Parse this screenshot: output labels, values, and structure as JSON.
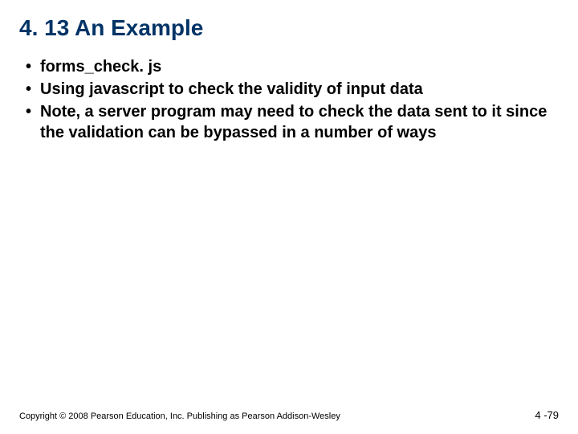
{
  "title": "4. 13 An Example",
  "bullets": [
    "forms_check. js",
    "Using javascript to check the validity of input data",
    "Note, a server program may need to check the data sent to it since the validation can be bypassed in a number of ways"
  ],
  "copyright": "Copyright © 2008 Pearson Education, Inc. Publishing as Pearson Addison-Wesley",
  "page_number": "4 -79"
}
